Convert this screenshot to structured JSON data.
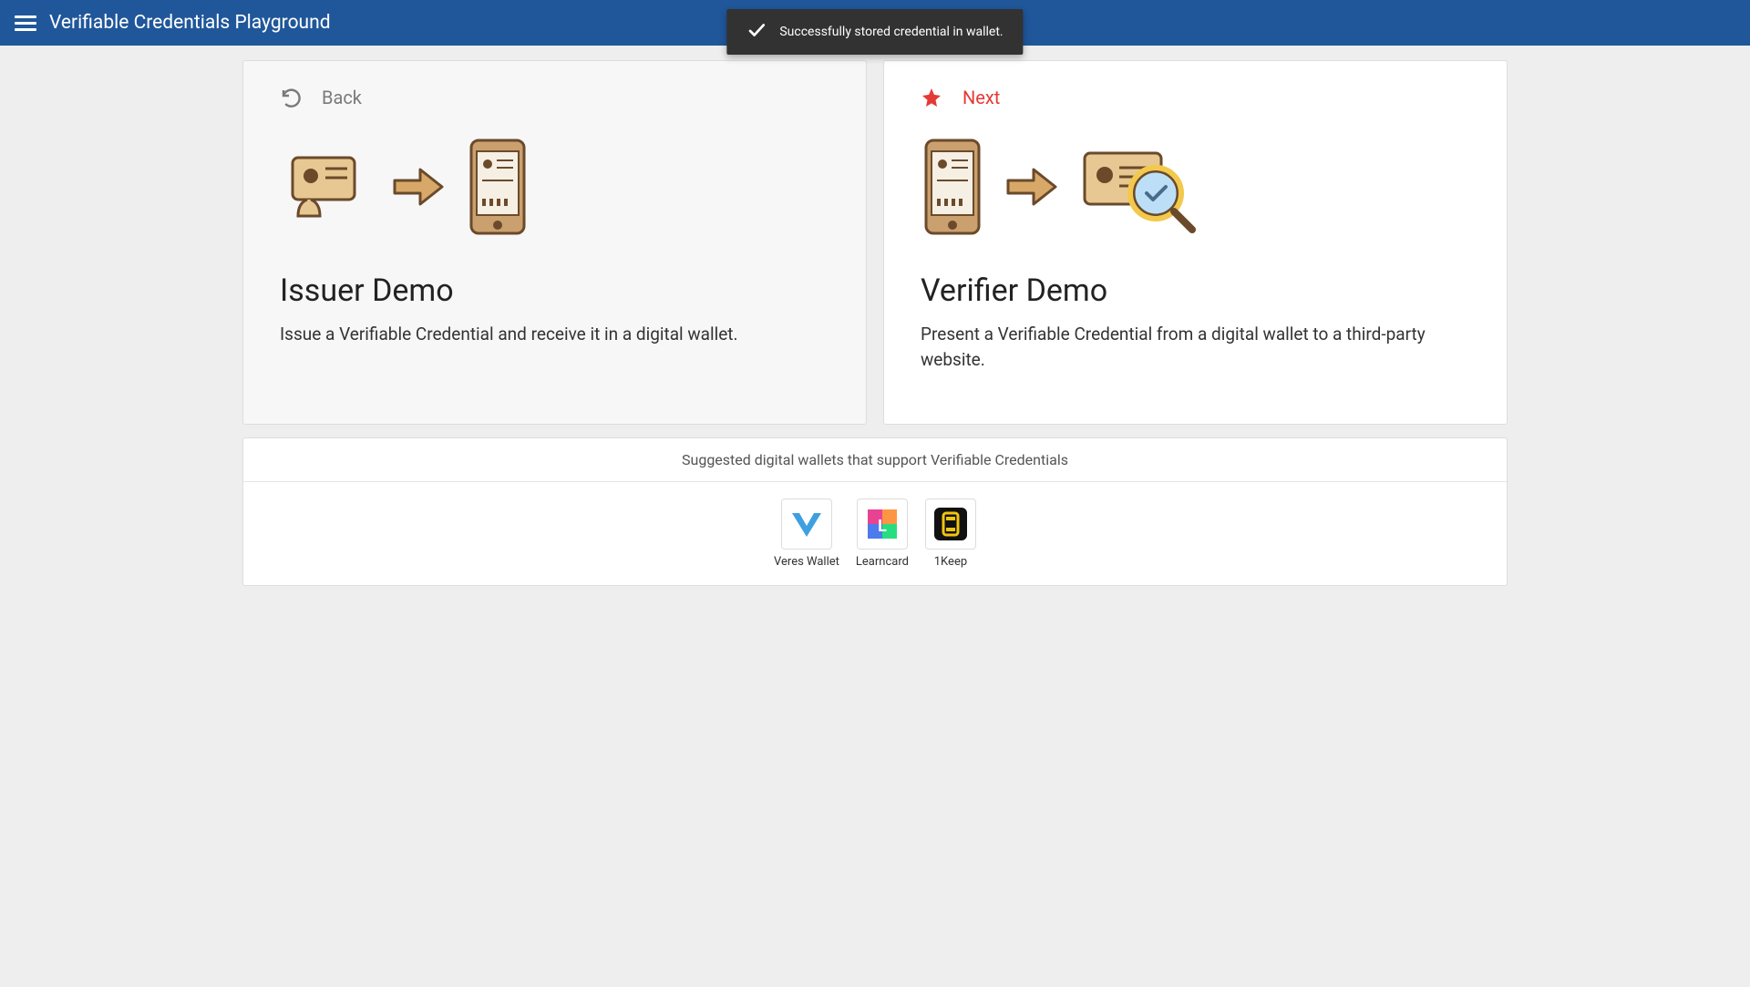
{
  "header": {
    "title": "Verifiable Credentials Playground"
  },
  "toast": {
    "message": "Successfully stored credential in wallet."
  },
  "cards": {
    "issuer": {
      "action_label": "Back",
      "title": "Issuer Demo",
      "description": "Issue a Verifiable Credential and receive it in a digital wallet."
    },
    "verifier": {
      "action_label": "Next",
      "title": "Verifier Demo",
      "description": "Present a Verifiable Credential from a digital wallet to a third-party website."
    }
  },
  "wallets": {
    "heading": "Suggested digital wallets that support Verifiable Credentials",
    "items": [
      {
        "label": "Veres Wallet"
      },
      {
        "label": "Learncard"
      },
      {
        "label": "1Keep"
      }
    ]
  }
}
